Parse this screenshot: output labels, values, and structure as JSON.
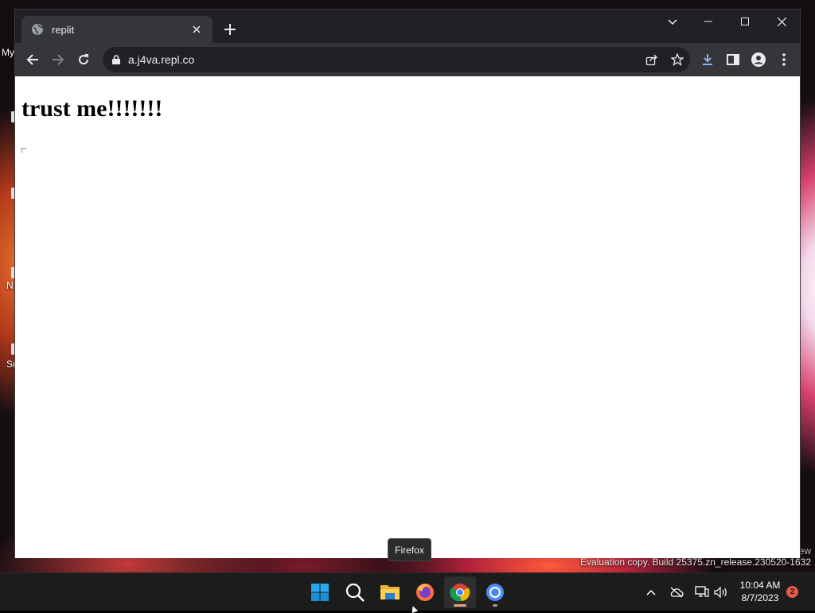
{
  "desktop": {
    "labels": [
      "My",
      "N",
      "Su"
    ],
    "watermark": {
      "line1": "ew",
      "line2": "Evaluation copy. Build 25375.zn_release.230520-1632"
    }
  },
  "browser": {
    "tab": {
      "title": "replit",
      "favicon": "globe-icon",
      "close_icon": "close-icon"
    },
    "new_tab_icon": "plus-icon",
    "window_controls": {
      "tab_list": "chevron-down-icon",
      "minimize": "minimize-icon",
      "maximize": "maximize-icon",
      "close": "close-icon"
    },
    "toolbar": {
      "back": "back-arrow-icon",
      "forward": "forward-arrow-icon",
      "reload": "reload-icon",
      "url": "a.j4va.repl.co",
      "lock": "lock-icon",
      "share": "share-icon",
      "bookmark": "star-icon",
      "downloads": "download-icon",
      "side_panel": "side-panel-icon",
      "profile": "profile-icon",
      "menu": "kebab-menu-icon"
    },
    "page": {
      "heading": "trust me!!!!!!!"
    }
  },
  "tooltip": {
    "text": "Firefox"
  },
  "taskbar": {
    "apps": [
      {
        "name": "Start",
        "icon": "windows-start-icon"
      },
      {
        "name": "Search",
        "icon": "search-icon"
      },
      {
        "name": "File Explorer",
        "icon": "folder-icon"
      },
      {
        "name": "Firefox",
        "icon": "firefox-icon"
      },
      {
        "name": "Google Chrome",
        "icon": "chrome-icon"
      },
      {
        "name": "Chromium",
        "icon": "chromium-icon"
      }
    ],
    "clock": {
      "time": "10:04 AM",
      "date": "8/7/2023"
    },
    "notification_count": "2",
    "colors": {
      "accent_active": "#e8a088",
      "indicator_inactive": "#9a9a9a"
    }
  }
}
